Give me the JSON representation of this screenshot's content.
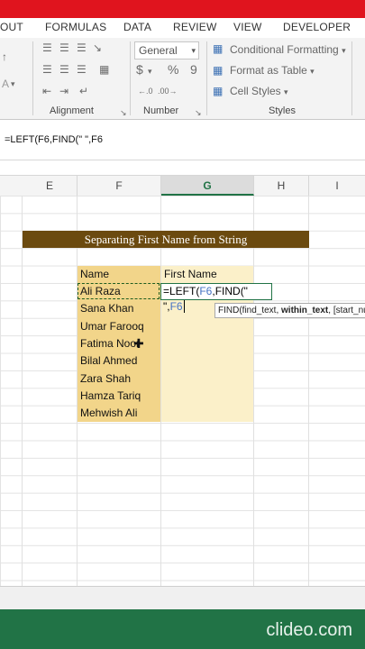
{
  "ribbon_tabs": [
    "OUT",
    "FORMULAS",
    "DATA",
    "REVIEW",
    "VIEW",
    "DEVELOPER"
  ],
  "ribbon": {
    "alignment_label": "Alignment",
    "number_label": "Number",
    "styles_label": "Styles",
    "number_format": "General",
    "conditional_formatting": "Conditional Formatting",
    "format_as_table": "Format as Table",
    "cell_styles": "Cell Styles",
    "currency_symbol": "$",
    "percent_symbol": "%",
    "comma_symbol": "9"
  },
  "formula_bar": {
    "text": "=LEFT(F6,FIND(\" \",F6"
  },
  "columns": [
    "E",
    "F",
    "G",
    "H",
    "I"
  ],
  "sheet": {
    "banner": "Separating First Name from String",
    "header_name": "Name",
    "header_first": "First Name",
    "names": [
      "Ali Raza",
      "Sana Khan",
      "Umar Farooq",
      "Fatima Noor",
      "Bilal Ahmed",
      "Zara Shah",
      "Hamza Tariq",
      "Mehwish Ali"
    ],
    "edit_prefix": "=LEFT(",
    "edit_ref1": "F6",
    "edit_mid": ",FIND(\" \",",
    "edit_ref2": "F6"
  },
  "tooltip": {
    "func": "FIND(find_text, ",
    "bold_arg": "within_text",
    "rest": ", [start_num])"
  },
  "watermark": "clideo.com",
  "colors": {
    "excel_green": "#217346",
    "banner_brown": "#6b4a0f",
    "name_fill": "#f2d58a",
    "first_fill": "#fbf0c9",
    "ref_blue": "#4472c4"
  }
}
